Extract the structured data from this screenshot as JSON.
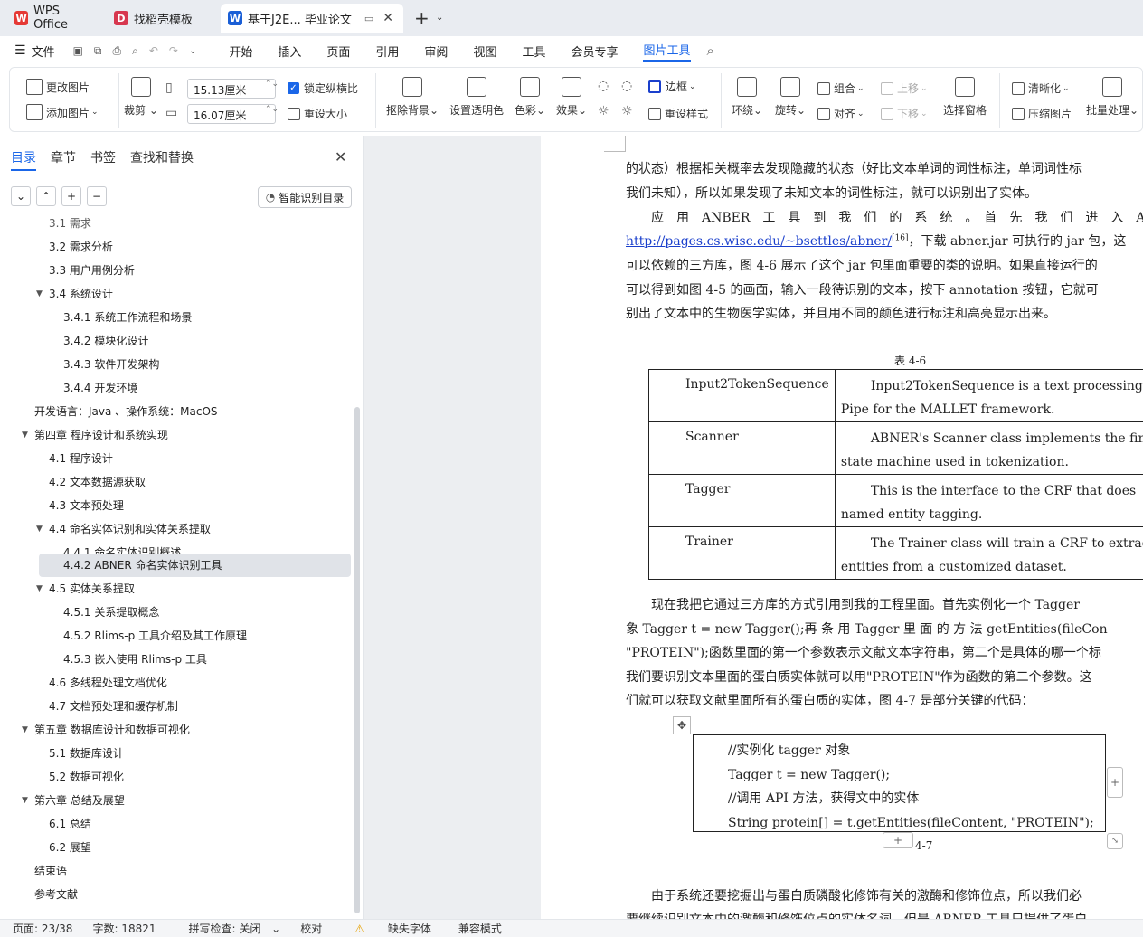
{
  "tabs": [
    {
      "label": "WPS Office",
      "icon": "wps-logo-icon",
      "color": "#e53935"
    },
    {
      "label": "找稻壳模板",
      "icon": "docer-icon",
      "color": "#d7374f"
    },
    {
      "label": "基于J2E... 毕业论文",
      "icon": "word-doc-icon",
      "color": "#1a5fd6"
    }
  ],
  "menu": {
    "file": "文件",
    "items": [
      "开始",
      "插入",
      "页面",
      "引用",
      "审阅",
      "视图",
      "工具",
      "会员专享",
      "图片工具"
    ],
    "active": "图片工具"
  },
  "ribbon": {
    "change_picture": "更改图片",
    "add_picture": "添加图片",
    "crop": "裁剪",
    "width_value": "15.13厘米",
    "height_value": "16.07厘米",
    "lock_ratio": "锁定纵横比",
    "resize": "重设大小",
    "remove_bg": "抠除背景",
    "set_transparent": "设置透明色",
    "color": "色彩",
    "effect": "效果",
    "border": "边框",
    "reset_style": "重设样式",
    "wrap": "环绕",
    "rotate": "旋转",
    "group": "组合",
    "align": "对齐",
    "move_up": "上移",
    "move_down": "下移",
    "selection_pane": "选择窗格",
    "sharpen": "清晰化",
    "compress": "压缩图片",
    "batch": "批量处理"
  },
  "nav": {
    "tabs": [
      "目录",
      "章节",
      "书签",
      "查找和替换"
    ],
    "smart_btn": "智能识别目录",
    "items": [
      {
        "label": "3.1 需求",
        "level": 2
      },
      {
        "label": "3.2  需求分析",
        "level": 2
      },
      {
        "label": "3.3  用户用例分析",
        "level": 2
      },
      {
        "label": "3.4  系统设计",
        "level": 2,
        "expanded": true
      },
      {
        "label": "3.4.1  系统工作流程和场景",
        "level": 3
      },
      {
        "label": "3.4.2  模块化设计",
        "level": 3
      },
      {
        "label": "3.4.3  软件开发架构",
        "level": 3
      },
      {
        "label": "3.4.4  开发环境",
        "level": 3
      },
      {
        "label": "开发语言：Java 、操作系统：MacOS",
        "level": 1
      },
      {
        "label": "第四章  程序设计和系统实现",
        "level": 1,
        "expanded": true
      },
      {
        "label": "4.1  程序设计",
        "level": 2
      },
      {
        "label": "4.2  文本数据源获取",
        "level": 2
      },
      {
        "label": "4.3  文本预处理",
        "level": 2
      },
      {
        "label": "4.4  命名实体识别和实体关系提取",
        "level": 2,
        "expanded": true
      },
      {
        "label": "4.4.1 命名实体识别概述",
        "level": 3
      },
      {
        "label": "4.4.2 ABNER 命名实体识别工具",
        "level": 3,
        "selected": true
      },
      {
        "label": "4.5  实体关系提取",
        "level": 2,
        "expanded": true
      },
      {
        "label": "4.5.1  关系提取概念",
        "level": 3
      },
      {
        "label": "4.5.2 Rlims-p 工具介绍及其工作原理",
        "level": 3
      },
      {
        "label": "4.5.3  嵌入使用 Rlims-p 工具",
        "level": 3
      },
      {
        "label": "4.6  多线程处理文档优化",
        "level": 2
      },
      {
        "label": "4.7  文档预处理和缓存机制",
        "level": 2
      },
      {
        "label": "第五章  数据库设计和数据可视化",
        "level": 1,
        "expanded": true
      },
      {
        "label": "5.1 数据库设计",
        "level": 2
      },
      {
        "label": "5.2  数据可视化",
        "level": 2
      },
      {
        "label": "第六章  总结及展望",
        "level": 1,
        "expanded": true
      },
      {
        "label": "6.1  总结",
        "level": 2
      },
      {
        "label": "6.2  展望",
        "level": 2
      },
      {
        "label": "结束语",
        "level": 1
      },
      {
        "label": "参考文献",
        "level": 1
      }
    ]
  },
  "doc": {
    "lines": [
      "的状态）根据相关概率去发现隐藏的状态（好比文本单词的词性标注，单词词性标",
      "我们未知），所以如果发现了未知文本的词性标注，就可以识别出了实体。",
      "　　应　用　ANBER　工　具　到　我　们　的　系　统　。　首　先　我　们　进　入　ANBER　网",
      "可以依赖的三方库，图 4-6 展示了这个 jar 包里面重要的类的说明。如果直接运行的",
      "可以得到如图 4-5 的画面，输入一段待识别的文本，按下 annotation 按钮，它就可",
      "别出了文本中的生物医学实体，并且用不同的颜色进行标注和高亮显示出来。"
    ],
    "link": "http://pages.cs.wisc.edu/~bsettles/abner/",
    "cite": "[16]",
    "link_tail": "，下载 abner.jar 可执行的 jar 包，这",
    "table_caption": "表 4-6",
    "table": [
      {
        "name": "Input2TokenSequence",
        "desc1": "Input2TokenSequence  is  a  text  processing",
        "desc2": "Pipe for the MALLET framework."
      },
      {
        "name": "Scanner",
        "desc1": "ABNER's Scanner class implements the finite",
        "desc2": "state machine used in tokenization."
      },
      {
        "name": "Tagger",
        "desc1": "This  is  the  interface  to  the  CRF  that  does",
        "desc2": "named entity tagging."
      },
      {
        "name": "Trainer",
        "desc1": "The Trainer class will train a CRF to extract",
        "desc2": "entities from a customized dataset."
      }
    ],
    "lines2": [
      "　　现在我把它通过三方库的方式引用到我的工程里面。首先实例化一个 Tagger",
      "象  Tagger  t  =  new  Tagger();再 条 用  Tagger  里 面 的 方 法  getEntities(fileCon",
      "\"PROTEIN\");函数里面的第一个参数表示文献文本字符串，第二个是具体的哪一个标",
      "我们要识别文本里面的蛋白质实体就可以用\"PROTEIN\"作为函数的第二个参数。这",
      "们就可以获取文献里面所有的蛋白质的实体，图 4-7 是部分关键的代码："
    ],
    "code": [
      "//实例化 tagger 对象",
      "Tagger t = new Tagger();",
      "//调用 API 方法，获得文中的实体",
      "String protein[] = t.getEntities(fileContent, \"PROTEIN\");"
    ],
    "figure_caption": "4-7",
    "lines3": [
      "　　由于系统还要挖掘出与蛋白质磷酸化修饰有关的激酶和修饰位点，所以我们必",
      "要继续识别文本中的激酶和修饰位点的实体名词，但是 ABNER 工具只提供了蛋白"
    ]
  },
  "status": {
    "page": "页面: 23/38",
    "words": "字数: 18821",
    "spell": "拼写检查: 关闭",
    "proof": "校对",
    "missing_font": "缺失字体",
    "compat": "兼容模式"
  },
  "colors": {
    "accent": "#1a66e8",
    "link": "#1a3fcc"
  }
}
